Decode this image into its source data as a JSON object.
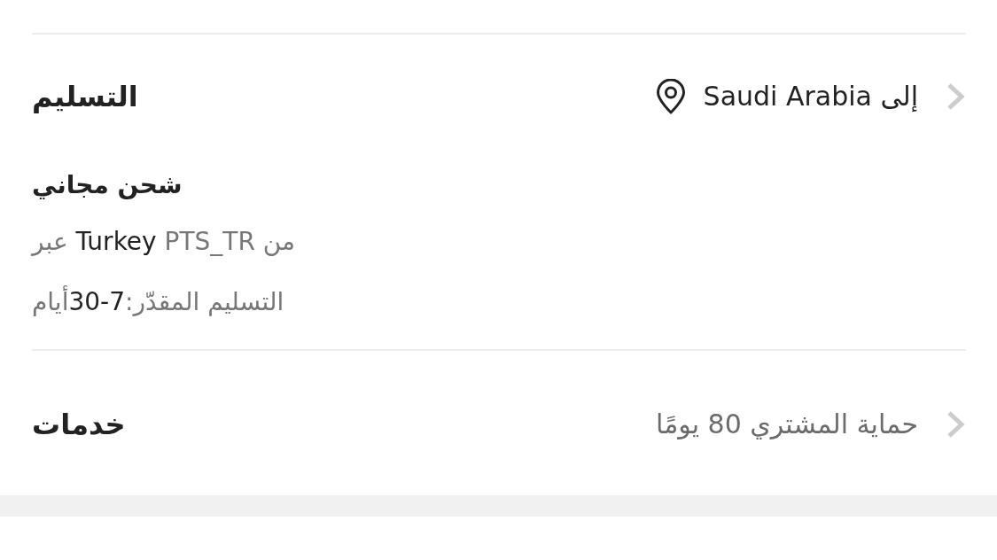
{
  "delivery": {
    "title": "التسليم",
    "destination": "إلى Saudi Arabia",
    "shipping_title": "شحن مجاني",
    "route": [
      {
        "text": "من",
        "emphasis": false
      },
      {
        "text": "PTS_TR",
        "emphasis": false
      },
      {
        "text": "Turkey",
        "emphasis": true
      },
      {
        "text": "عبر",
        "emphasis": false
      }
    ],
    "estimate": [
      {
        "text": "التسليم المقدّر:",
        "emphasis": false
      },
      {
        "text": "7-30",
        "emphasis": true
      },
      {
        "text": "أيام",
        "emphasis": false
      }
    ]
  },
  "services": {
    "title": "خدمات",
    "value": "حماية المشتري 80 يومًا"
  }
}
